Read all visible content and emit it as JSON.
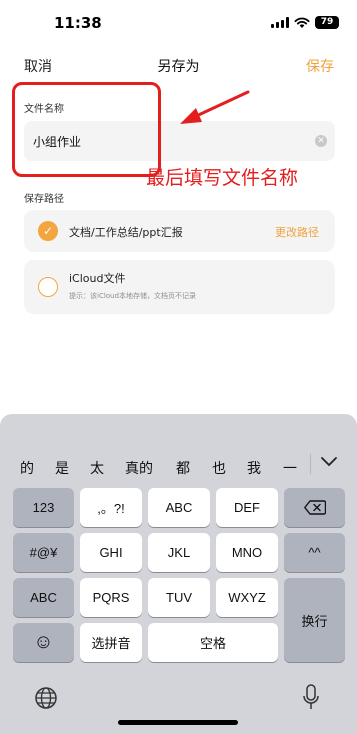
{
  "status": {
    "time": "11:38",
    "battery": "79"
  },
  "nav": {
    "cancel": "取消",
    "title": "另存为",
    "save": "保存"
  },
  "file_name": {
    "label": "文件名称",
    "value": "小组作业"
  },
  "annotation": {
    "text": "最后填写文件名称",
    "color": "#e41e1e"
  },
  "save_path": {
    "label": "保存路径",
    "options": [
      {
        "name": "文档/工作总结/ppt汇报",
        "selected": true,
        "action": "更改路径"
      },
      {
        "name": "iCloud文件",
        "selected": false,
        "hint": "提示：该iCloud本地存储，文档页不记录"
      }
    ]
  },
  "keyboard": {
    "candidates": [
      "的",
      "是",
      "太",
      "真的",
      "都",
      "也",
      "我",
      "一"
    ],
    "keys": {
      "num": "123",
      "punct": ",。?!",
      "abc": "ABC",
      "def": "DEF",
      "symbols": "#@¥",
      "ghi": "GHI",
      "jkl": "JKL",
      "mno": "MNO",
      "caret": "^^",
      "abc_switch": "ABC",
      "pqrs": "PQRS",
      "tuv": "TUV",
      "wxyz": "WXYZ",
      "return": "换行",
      "emoji": "☺",
      "pinyin": "选拼音",
      "space": "空格"
    }
  },
  "colors": {
    "accent": "#f0a23c",
    "keyboard_bg": "#d2d4da",
    "func_key": "#aeb3be"
  }
}
